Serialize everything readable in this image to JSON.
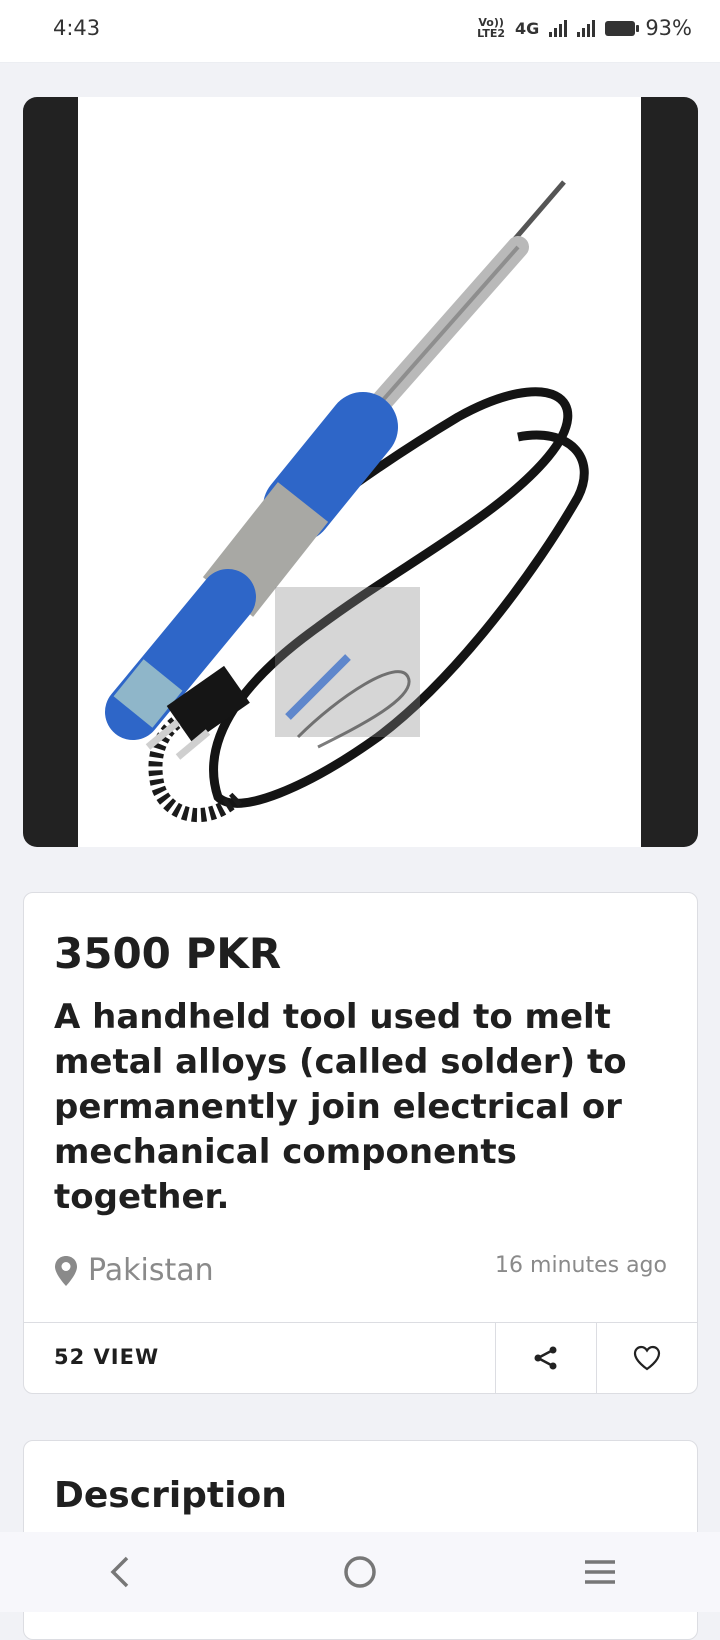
{
  "status_bar": {
    "time": "4:43",
    "network_top": "Vo))",
    "network_bottom": "LTE2",
    "network_type": "4G",
    "battery": "93%"
  },
  "listing": {
    "price": "3500 PKR",
    "title": "A handheld tool used to melt metal alloys (called solder) to permanently join electrical or mechanical components together.",
    "location": "Pakistan",
    "posted": "16 minutes ago",
    "views": "52 VIEW",
    "image_icon": "soldering-iron-photo"
  },
  "description": {
    "heading": "Description"
  },
  "icons": {
    "location": "map-pin-icon",
    "share": "share-icon",
    "favorite": "heart-icon",
    "back": "back-chevron-icon",
    "home": "home-circle-icon",
    "recents": "menu-lines-icon"
  },
  "colors": {
    "background": "#f1f2f6",
    "image_frame": "#222222",
    "text_primary": "#1f1f1f",
    "text_muted": "#8a8a8a",
    "handle_blue": "#2e66c8"
  }
}
